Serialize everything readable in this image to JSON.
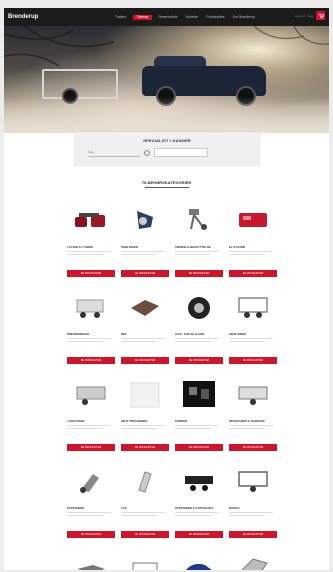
{
  "header": {
    "logo": "Brenderup",
    "nav": [
      "Trailers",
      "Tilbehør",
      "Reservedele",
      "Nyheder",
      "Forhandlere",
      "Om Brenderup"
    ],
    "active_nav_index": 1,
    "tools": [
      "Log ind",
      "Søg"
    ],
    "cart_icon": "cart-icon"
  },
  "hero": {
    "accent": "#d0152b"
  },
  "search": {
    "title": "SPECIALIST I KANNER",
    "placeholder": "Søg...",
    "button_label": ""
  },
  "categories": {
    "title": "TILBEHØRSKATEGORIER",
    "items": [
      {
        "name": "LYGTER & LYSBRO",
        "icon": "lights-icon",
        "button": "SE PRODUKTER"
      },
      {
        "name": "KOBLINGER",
        "icon": "coupling-icon",
        "button": "SE PRODUKTER"
      },
      {
        "name": "SIKRING & BESKYTTELSE",
        "icon": "lock-icon",
        "button": "SE PRODUKTER"
      },
      {
        "name": "EL-SYSTEM",
        "icon": "electric-box-icon",
        "button": "SE PRODUKTER"
      },
      {
        "name": "PRESSENINGER",
        "icon": "tarp-trailer-icon",
        "button": "SE PRODUKTER"
      },
      {
        "name": "NET",
        "icon": "net-icon",
        "button": "SE PRODUKTER"
      },
      {
        "name": "HJUL, FÆLGE & DÆK",
        "icon": "wheel-icon",
        "button": "SE PRODUKTER"
      },
      {
        "name": "HØJE SIDER",
        "icon": "cage-trailer-icon",
        "button": "SE PRODUKTER"
      },
      {
        "name": "LÅGKASSER",
        "icon": "box-trailer-icon",
        "button": "SE PRODUKTER"
      },
      {
        "name": "HØJT PRESSENING",
        "icon": "cover-icon",
        "button": "SE PRODUKTER"
      },
      {
        "name": "RAMPER",
        "icon": "ramps-icon",
        "button": "SE PRODUKTER"
      },
      {
        "name": "REDSKABER & TILBEHØR",
        "icon": "accessory-trailer-icon",
        "button": "SE PRODUKTER"
      },
      {
        "name": "STØTTEBEN",
        "icon": "jockey-wheel-icon",
        "button": "SE PRODUKTER"
      },
      {
        "name": "LÅS",
        "icon": "hitch-lock-icon",
        "button": "SE PRODUKTER"
      },
      {
        "name": "STØTTEBEN & STØTTEHJUL",
        "icon": "flatbed-trailer-icon",
        "button": "SE PRODUKTER"
      },
      {
        "name": "ØVRIGT",
        "icon": "tipper-trailer-icon",
        "button": "SE PRODUKTER"
      },
      {
        "name": "",
        "icon": "coupling-head-icon",
        "button": ""
      },
      {
        "name": "",
        "icon": "small-trailer-icon",
        "button": ""
      },
      {
        "name": "",
        "icon": "car-trailer-icon",
        "button": ""
      },
      {
        "name": "",
        "icon": "ramp-trailer-icon",
        "button": ""
      }
    ]
  }
}
